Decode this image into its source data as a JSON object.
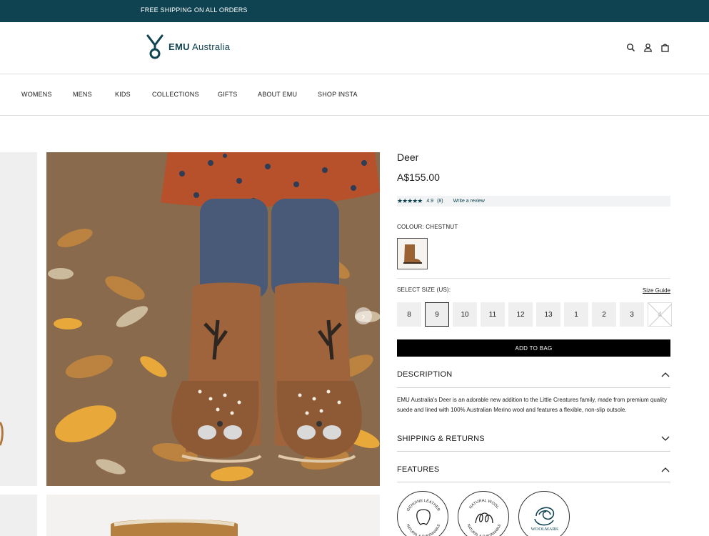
{
  "promo": {
    "text": "FREE SHIPPING ON ALL ORDERS"
  },
  "brand": {
    "name_bold": "EMU",
    "name_rest": " Australia"
  },
  "nav": {
    "items": [
      "WOMENS",
      "MENS",
      "KIDS",
      "COLLECTIONS",
      "GIFTS",
      "ABOUT EMU",
      "SHOP INSTA"
    ]
  },
  "product": {
    "title": "Deer",
    "price": "A$155.00",
    "stars": "★★★★★",
    "rating": "4.9",
    "review_count": "(8)",
    "write_review": "Write a review",
    "colour_label": "COLOUR: CHESTNUT",
    "size_label": "SELECT SIZE (US):",
    "size_guide": "Size Guide",
    "sizes": [
      "8",
      "9",
      "10",
      "11",
      "12",
      "13",
      "1",
      "2",
      "3",
      "4"
    ],
    "selected_size": "9",
    "unavailable_size": "4",
    "add_to_bag": "ADD TO BAG"
  },
  "accordion": {
    "description_title": "DESCRIPTION",
    "description_text": "EMU Australia's Deer is an adorable new addition to the Little Creatures family, made from premium quality suede and lined with 100% Australian Merino wool and features a flexible, non-slip outsole.",
    "shipping_title": "SHIPPING & RETURNS",
    "features_title": "FEATURES"
  },
  "badges": {
    "leather_top": "GENUINE LEATHER",
    "leather_bottom": "NATURAL & SUSTAINABLE",
    "wool_top": "NATURAL WOOL",
    "wool_bottom": "NATURAL & SUSTAINABLE",
    "woolmark": "WOOLMARK"
  },
  "colors": {
    "brand": "#0f4351",
    "button": "#000000"
  }
}
